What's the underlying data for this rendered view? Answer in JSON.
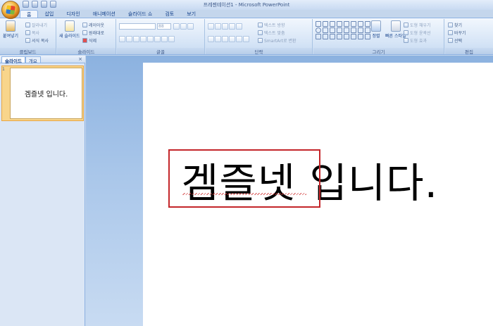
{
  "window": {
    "title": "프레젠테이션1 - Microsoft PowerPoint"
  },
  "tabs": [
    {
      "label": "홈",
      "active": true
    },
    {
      "label": "삽입",
      "active": false
    },
    {
      "label": "디자인",
      "active": false
    },
    {
      "label": "애니메이션",
      "active": false
    },
    {
      "label": "슬라이드 쇼",
      "active": false
    },
    {
      "label": "검토",
      "active": false
    },
    {
      "label": "보기",
      "active": false
    }
  ],
  "ribbon": {
    "clipboard": {
      "label": "클립보드",
      "paste": "붙여넣기",
      "cut": "잘라내기",
      "copy": "복사",
      "format_painter": "서식 복사"
    },
    "slides": {
      "label": "슬라이드",
      "new_slide": "새 슬라이드",
      "layout": "레이아웃",
      "reset": "원래대로",
      "delete": "삭제"
    },
    "font": {
      "label": "글꼴",
      "size": "88"
    },
    "paragraph": {
      "label": "단락",
      "text_direction": "텍스트 방향",
      "align_text": "텍스트 맞춤",
      "smartart": "SmartArt로 변환"
    },
    "drawing": {
      "label": "그리기",
      "arrange": "정렬",
      "quick_styles": "빠른 스타일",
      "shape_fill": "도형 채우기",
      "shape_outline": "도형 윤곽선",
      "shape_effects": "도형 효과"
    },
    "editing": {
      "label": "편집",
      "find": "찾기",
      "replace": "바꾸기",
      "select": "선택"
    }
  },
  "panel": {
    "tab_slides": "슬라이드",
    "tab_outline": "개요",
    "close": "×",
    "slide_number": "1",
    "thumbnail_text": "겜즐넷 입니다."
  },
  "slide": {
    "text": "겜즐넷 입니다."
  },
  "colors": {
    "selection_border": "#c4262a",
    "ribbon_text": "#15428b"
  }
}
